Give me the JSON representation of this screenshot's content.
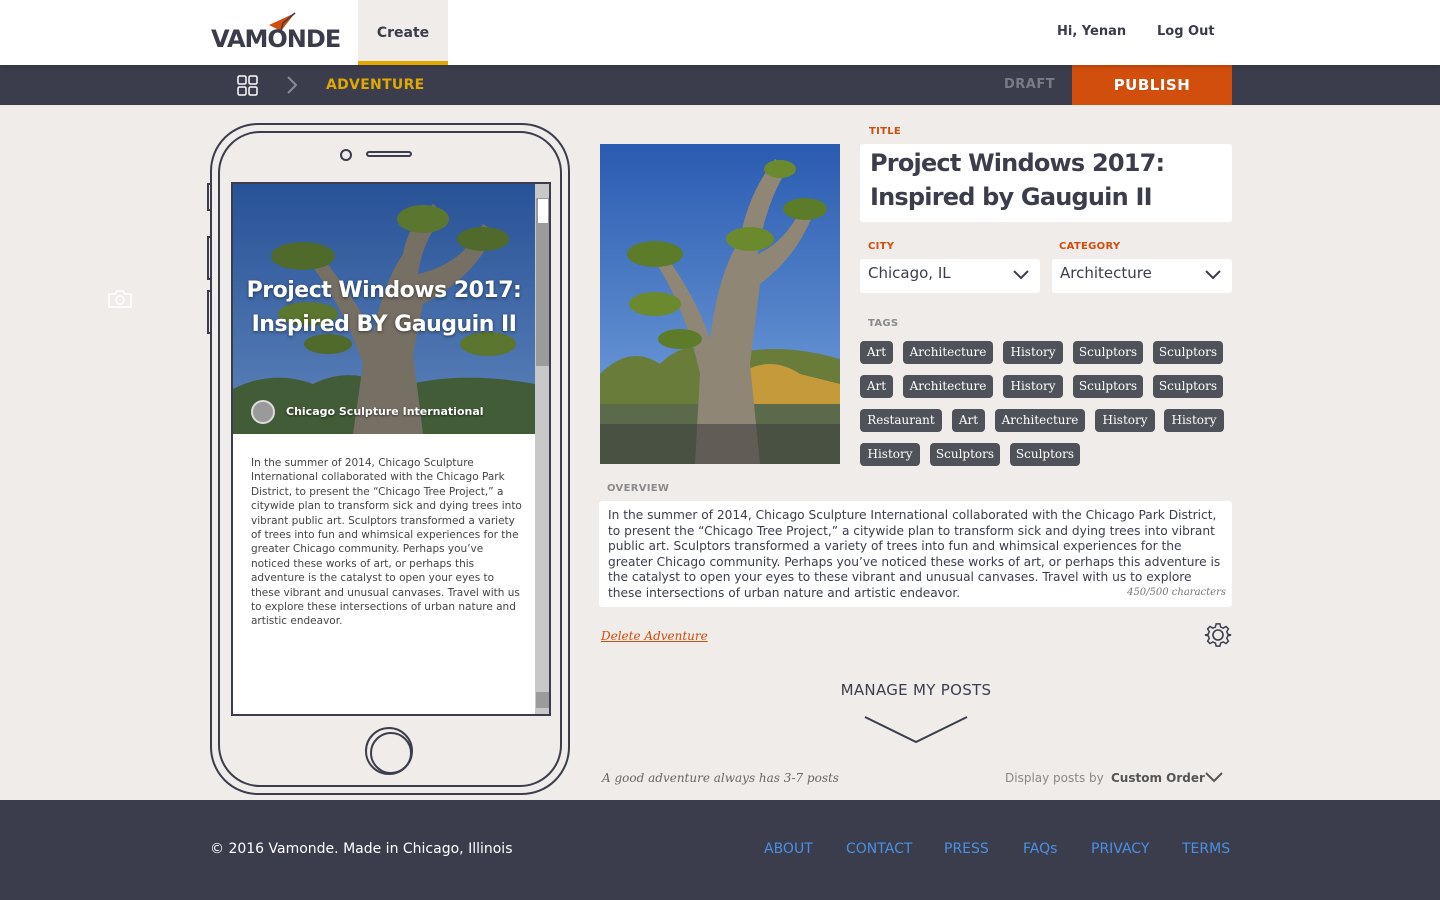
{
  "header": {
    "logo_text": "VAMONDE",
    "create_tab": "Create",
    "greeting": "Hi, Yenan",
    "logout": "Log Out"
  },
  "subbar": {
    "breadcrumb": "ADVENTURE",
    "draft": "DRAFT",
    "publish": "PUBLISH"
  },
  "preview": {
    "title": "Project Windows 2017: Inspired BY Gauguin II",
    "author": "Chicago Sculpture International",
    "body": "In the summer of 2014, Chicago Sculpture International collaborated with the Chicago Park District, to present the “Chicago Tree Project,” a citywide plan to transform sick and dying trees into vibrant public art. Sculptors transformed a variety of trees into fun and whimsical experiences for the greater Chicago community. Perhaps you’ve noticed these works of art, or perhaps this adventure is the catalyst to open your eyes to these vibrant and unusual canvases. Travel with us to explore these intersections of urban nature and artistic endeavor."
  },
  "form": {
    "title_label": "TITLE",
    "title_value": "Project Windows 2017: Inspired by Gauguin II",
    "city_label": "CITY",
    "city_value": "Chicago, IL",
    "category_label": "CATEGORY",
    "category_value": "Architecture",
    "tags_label": "TAGS",
    "tags": [
      "Art",
      "Architecture",
      "History",
      "Sculptors",
      "Sculptors",
      "Art",
      "Architecture",
      "History",
      "Sculptors",
      "Sculptors",
      "Restaurant",
      "Art",
      "Architecture",
      "History",
      "History",
      "History",
      "Sculptors",
      "Sculptors"
    ],
    "overview_label": "OVERVIEW",
    "overview_value": "In the summer of 2014, Chicago Sculpture International collaborated with the Chicago Park District, to present the “Chicago Tree Project,” a citywide plan to transform sick and dying trees into vibrant public art. Sculptors transformed a variety of trees into fun and whimsical experiences for the greater Chicago community. Perhaps you’ve noticed these works of art, or perhaps this adventure is the catalyst to open your eyes to these vibrant and unusual canvases. Travel with us to explore these intersections of urban nature and artistic endeavor.",
    "char_count": "450/500 characters",
    "delete_link": "Delete Adventure"
  },
  "posts": {
    "manage_label": "MANAGE MY POSTS",
    "hint": "A good adventure always  has 3-7 posts",
    "display_label": "Display posts by",
    "display_value": "Custom Order"
  },
  "footer": {
    "copyright": "© 2016 Vamonde. Made in Chicago, Illinois",
    "links": [
      "ABOUT",
      "CONTACT",
      "PRESS",
      "FAQs",
      "PRIVACY",
      "TERMS"
    ]
  },
  "colors": {
    "accent": "#d14e0c",
    "breadcrumb": "#e0a800",
    "dark": "#3b3d4d",
    "link": "#4a90e2"
  }
}
